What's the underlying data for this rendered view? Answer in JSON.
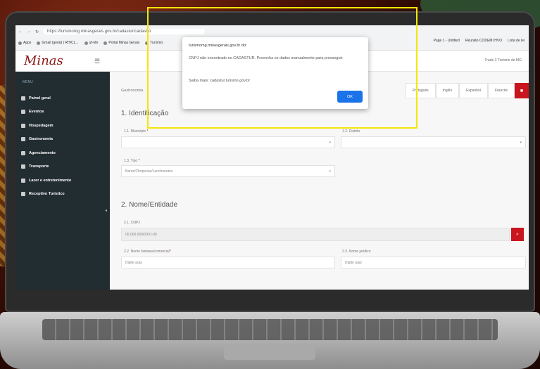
{
  "browser": {
    "url": "https://turismomg.minasgerais.gov.br/cadastur/cadastro",
    "bookmarks": [
      "Apps",
      "Gmail (geral) | RH/CL...",
      "uf-nfe",
      "Portal Minas Gerais",
      "Turismo"
    ],
    "bookmarks_right": [
      "Page 1 - Untitled",
      "Reunião CODEMI HVO",
      "Lista de lei"
    ]
  },
  "header": {
    "logo": "Minas",
    "user": "Trade 3 Turismo de MG"
  },
  "sidebar": {
    "heading": "MENU",
    "items": [
      {
        "label": "Painel geral"
      },
      {
        "label": "Eventos"
      },
      {
        "label": "Hospedagem"
      },
      {
        "label": "Gastronomia"
      },
      {
        "label": "Agenciamento"
      },
      {
        "label": "Transporte"
      },
      {
        "label": "Lazer e entretenimento"
      },
      {
        "label": "Receptivo Turístico"
      }
    ]
  },
  "content": {
    "breadcrumb": "Gastronomia",
    "tabs": [
      "Português",
      "Inglês",
      "Espanhol",
      "Francês"
    ],
    "section1": "1. Identificação",
    "municipio_label": "1.1. Município",
    "distrito_label": "1.2. Distrito",
    "tipo_label": "1.3. Tipo",
    "tipo_value": "Bares/Choperias/Lanchonetes",
    "section2": "2. Nome/Entidade",
    "cnpj_label": "2.1. CNPJ",
    "cnpj_value": "00.000.000/0001-00",
    "nome_fantasia_label": "2.2. Nome fantasia/comercial",
    "nome_juridico_label": "2.3. Nome jurídico",
    "placeholder": "Digite aqui"
  },
  "dialog": {
    "title": "turismomg.minasgerais.gov.br diz",
    "message": "CNPJ não encontrado no CADASTUR. Preencha os dados manualmente para prosseguir.",
    "more": "Saiba mais: cadastur.turismo.gov.br",
    "ok": "OK"
  }
}
